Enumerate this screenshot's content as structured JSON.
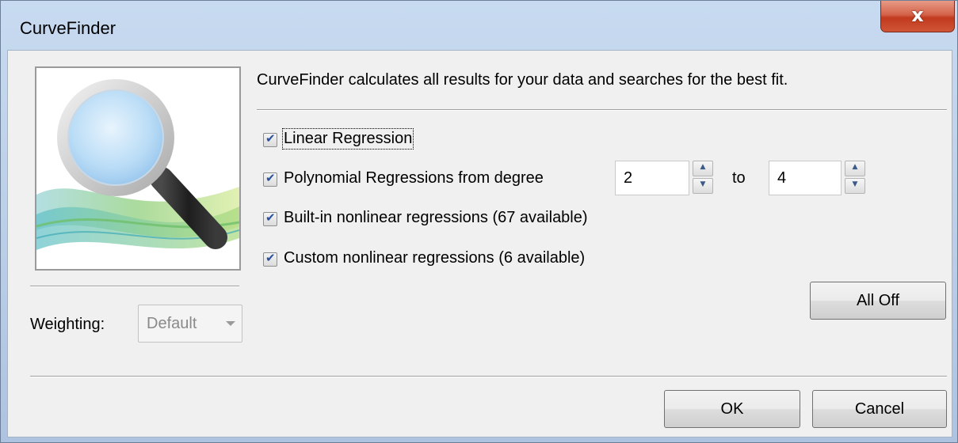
{
  "window": {
    "title": "CurveFinder",
    "close_label": "x"
  },
  "intro": "CurveFinder calculates all results for your data and searches for the best fit.",
  "options": [
    {
      "label": "Linear Regression",
      "checked": true
    },
    {
      "label": "Polynomial Regressions from degree",
      "checked": true
    },
    {
      "label": "Built-in nonlinear regressions (67 available)",
      "checked": true
    },
    {
      "label": "Custom nonlinear regressions (6 available)",
      "checked": true
    }
  ],
  "degree": {
    "from": "2",
    "to_label": "to",
    "to": "4"
  },
  "weighting": {
    "label": "Weighting:",
    "value": "Default"
  },
  "buttons": {
    "all_off": "All Off",
    "ok": "OK",
    "cancel": "Cancel"
  },
  "icons": {
    "logo": "magnifying-glass-icon",
    "close": "close-icon"
  }
}
